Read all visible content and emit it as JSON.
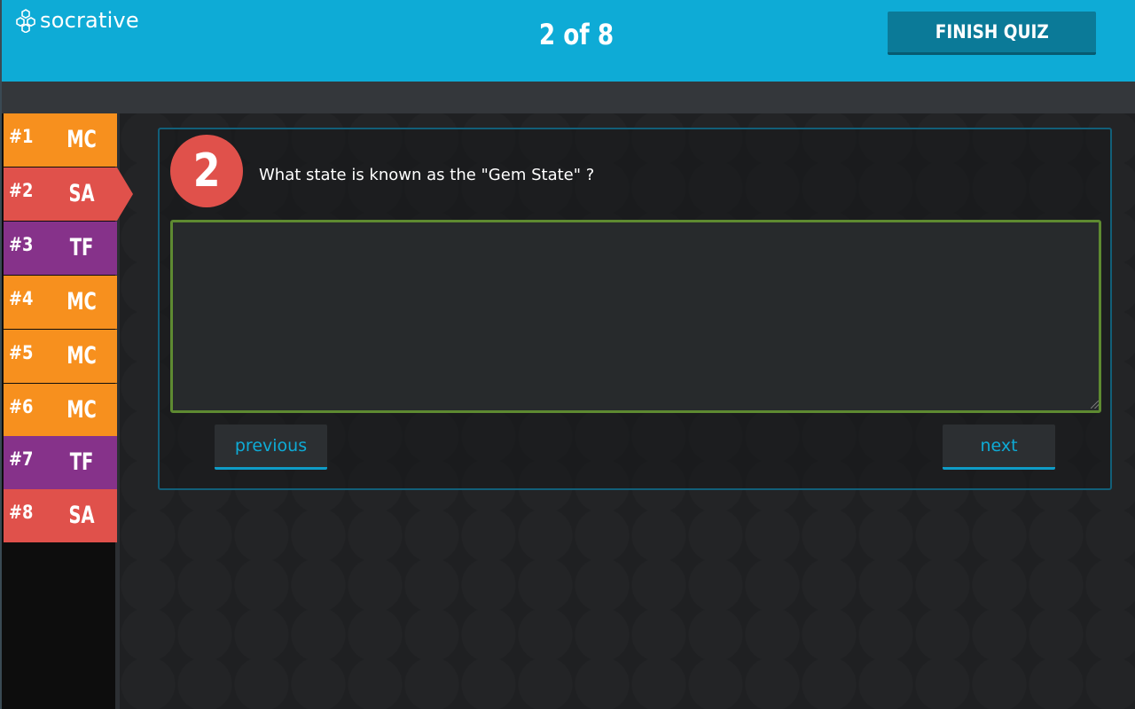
{
  "header": {
    "brand": "socrative",
    "progress": "2 of 8",
    "finish_label": "FINISH QUIZ"
  },
  "sidebar": {
    "items": [
      {
        "number": "#1",
        "type": "MC",
        "color": "#f7901e"
      },
      {
        "number": "#2",
        "type": "SA",
        "color": "#e0514b",
        "active": true
      },
      {
        "number": "#3",
        "type": "TF",
        "color": "#86328a"
      },
      {
        "number": "#4",
        "type": "MC",
        "color": "#f7901e"
      },
      {
        "number": "#5",
        "type": "MC",
        "color": "#f7901e"
      },
      {
        "number": "#6",
        "type": "MC",
        "color": "#f7901e"
      },
      {
        "number": "#7",
        "type": "TF",
        "color": "#86328a"
      },
      {
        "number": "#8",
        "type": "SA",
        "color": "#e0514b"
      }
    ]
  },
  "question": {
    "number": "2",
    "text": "What state is known as the \"Gem State\" ?",
    "answer_value": ""
  },
  "nav": {
    "previous_label": "previous",
    "next_label": "next"
  },
  "colors": {
    "header_bg": "#0eabd6",
    "finish_bg": "#0b7a98",
    "answer_border": "#5e8a31",
    "card_border": "#125f79",
    "badge_bg": "#e0514b"
  },
  "icons": {
    "brand": "hexagon-cluster-logo-icon"
  }
}
